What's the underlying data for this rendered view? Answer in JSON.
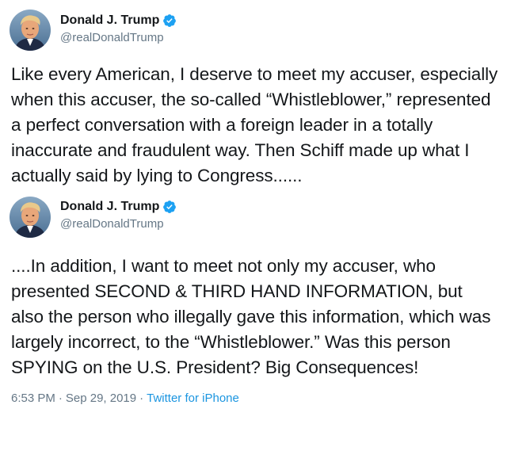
{
  "tweets": [
    {
      "author": {
        "name": "Donald J. Trump",
        "handle": "@realDonaldTrump",
        "verified": true
      },
      "text": "Like every American, I deserve to meet my accuser, especially when this accuser, the so-called “Whistleblower,” represented a perfect conversation with a foreign leader in a totally inaccurate and fraudulent way. Then Schiff made up what I actually said by lying to Congress......"
    },
    {
      "author": {
        "name": "Donald J. Trump",
        "handle": "@realDonaldTrump",
        "verified": true
      },
      "text": "....In addition, I want to meet not only my accuser, who presented SECOND & THIRD HAND INFORMATION, but also the person who illegally gave this information, which was largely incorrect, to the “Whistleblower.” Was this person SPYING on the U.S. President? Big Consequences!"
    }
  ],
  "meta": {
    "time": "6:53 PM",
    "separator": "·",
    "date": "Sep 29, 2019",
    "source": "Twitter for iPhone"
  },
  "colors": {
    "verified": "#1da1f2",
    "secondary_text": "#657786",
    "link": "#1b95e0"
  },
  "icons": {
    "verified": "verified-badge-icon",
    "avatar": "profile-photo"
  }
}
